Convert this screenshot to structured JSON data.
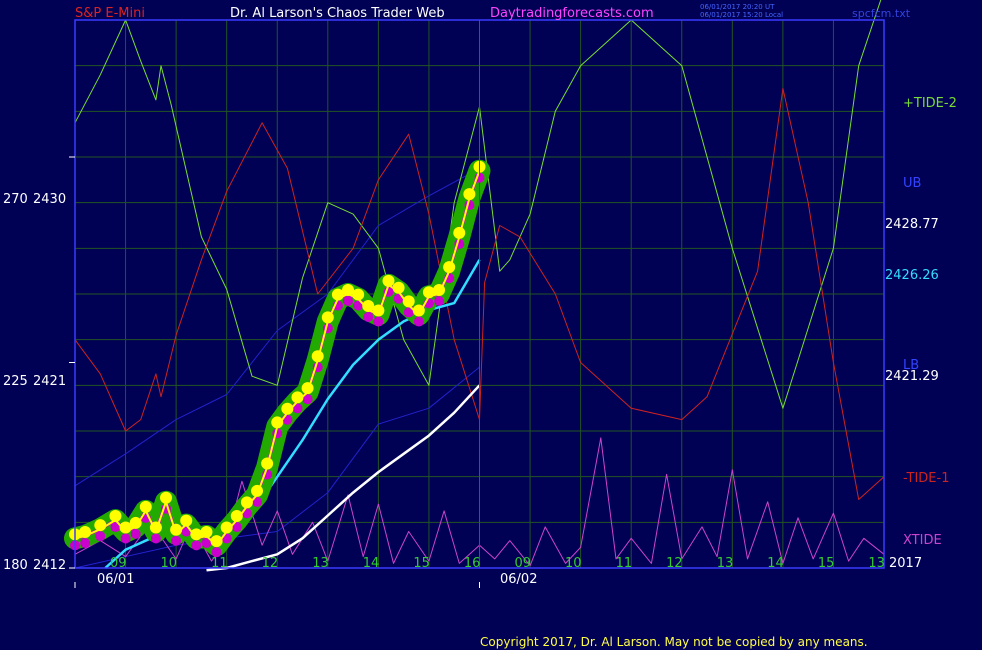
{
  "header": {
    "symbol": "S&P E-Mini",
    "title": "Dr. Al Larson's Chaos Trader Web",
    "site": "Daytradingforecasts.com",
    "stamp_line1": "06/01/2017 20:20 UT",
    "stamp_line2": "06/01/2017 15:20 Local",
    "file": "spcfcm.txt"
  },
  "footer": {
    "copyright": "Copyright 2017, Dr. Al Larson. May not be copied by any means."
  },
  "colors": {
    "background": "#000055",
    "frame": "#3b3bff",
    "grid": "#225522",
    "tide_plus": "#77dd33",
    "tide_minus": "#cc2222",
    "xtide": "#cc44cc",
    "fast_avg": "#33ddff",
    "slow_avg": "#ffffff",
    "band": "#2222cc",
    "price_yellow": "#ffff00",
    "price_magenta": "#cc00cc",
    "price_halo": "#22aa00"
  },
  "chart_data": {
    "type": "line",
    "title": "S&P E-Mini",
    "y_axis": {
      "range": [
        2412,
        2436
      ],
      "tick_labels": [
        {
          "inner": "180",
          "price": "2412",
          "value": 2412
        },
        {
          "inner": "225",
          "price": "2421",
          "value": 2421
        },
        {
          "inner": "270",
          "price": "2430",
          "value": 2430
        }
      ]
    },
    "x_axis": {
      "hour_ticks": [
        "09",
        "10",
        "11",
        "12",
        "13",
        "14",
        "15",
        "16",
        "09",
        "10",
        "11",
        "12",
        "13",
        "14",
        "15",
        "13"
      ],
      "dates": [
        "06/01",
        "06/02"
      ],
      "year": "2017",
      "range": [
        8,
        24
      ]
    },
    "right_labels": [
      {
        "text": "+TIDE-2",
        "role": "tide_plus"
      },
      {
        "text": "UB",
        "role": "band"
      },
      {
        "text": "2428.77",
        "role": "value_white"
      },
      {
        "text": "2426.26",
        "role": "value_cyan"
      },
      {
        "text": "LB",
        "role": "band"
      },
      {
        "text": "2421.29",
        "role": "value_white"
      },
      {
        "text": "-TIDE-1",
        "role": "tide_minus"
      },
      {
        "text": "XTIDE",
        "role": "xtide"
      }
    ],
    "grid": true,
    "series": [
      {
        "role": "price",
        "color": "#ffff00",
        "x": [
          8.0,
          8.2,
          8.5,
          8.8,
          9.0,
          9.2,
          9.4,
          9.6,
          9.8,
          10.0,
          10.2,
          10.4,
          10.6,
          10.8,
          11.0,
          11.2,
          11.4,
          11.6,
          11.8,
          12.0,
          12.2,
          12.4,
          12.6,
          12.8,
          13.0,
          13.2,
          13.4,
          13.6,
          13.8,
          14.0,
          14.2,
          14.4,
          14.6,
          14.8,
          15.0,
          15.2,
          15.4,
          15.6,
          15.8,
          16.0
        ],
        "y": [
          2413.3,
          2413.4,
          2413.7,
          2414.1,
          2413.6,
          2413.8,
          2414.5,
          2413.6,
          2414.9,
          2413.5,
          2413.9,
          2413.3,
          2413.4,
          2413.0,
          2413.6,
          2414.1,
          2414.7,
          2415.2,
          2416.4,
          2418.2,
          2418.8,
          2419.3,
          2419.7,
          2421.1,
          2422.8,
          2423.8,
          2424.0,
          2423.8,
          2423.3,
          2423.1,
          2424.4,
          2424.1,
          2423.5,
          2423.1,
          2423.9,
          2424.0,
          2425.0,
          2426.5,
          2428.2,
          2429.4
        ]
      },
      {
        "role": "fast_average",
        "color": "#33ddff",
        "x": [
          8.6,
          9.0,
          9.5,
          10.0,
          10.5,
          11.0,
          11.5,
          12.0,
          12.5,
          13.0,
          13.5,
          14.0,
          14.5,
          15.0,
          15.5,
          16.0
        ],
        "y": [
          2412.0,
          2412.8,
          2413.3,
          2413.5,
          2413.3,
          2413.7,
          2414.4,
          2416.0,
          2417.6,
          2419.4,
          2420.9,
          2422.0,
          2422.8,
          2423.3,
          2423.6,
          2425.5
        ]
      },
      {
        "role": "slow_average",
        "color": "#ffffff",
        "x": [
          10.6,
          11.0,
          11.5,
          12.0,
          12.5,
          13.0,
          13.5,
          14.0,
          14.5,
          15.0,
          15.5,
          16.0
        ],
        "y": [
          2411.9,
          2412.0,
          2412.3,
          2412.6,
          2413.3,
          2414.3,
          2415.3,
          2416.2,
          2417.0,
          2417.8,
          2418.8,
          2420.0
        ]
      },
      {
        "role": "upper_band",
        "color": "#2222cc",
        "x": [
          8.0,
          9.0,
          10.0,
          11.0,
          12.0,
          13.0,
          14.0,
          15.0,
          16.0
        ],
        "y": [
          2415.6,
          2417.0,
          2418.5,
          2419.6,
          2422.4,
          2424.0,
          2427.0,
          2428.3,
          2429.5
        ]
      },
      {
        "role": "lower_band",
        "color": "#2222cc",
        "x": [
          8.0,
          9.0,
          10.0,
          11.0,
          12.0,
          13.0,
          14.0,
          15.0,
          16.0
        ],
        "y": [
          2412.0,
          2412.5,
          2413.0,
          2413.3,
          2413.6,
          2415.3,
          2418.3,
          2419.0,
          2420.8
        ]
      },
      {
        "role": "tide_plus",
        "color": "#77dd33",
        "x": [
          8.0,
          8.5,
          9.0,
          9.3,
          9.6,
          9.7,
          9.9,
          10.5,
          11.0,
          11.5,
          12.0,
          12.5,
          13.0,
          13.5,
          14.0,
          14.5,
          15.0,
          15.5,
          16.0,
          16.4,
          16.6,
          17.0,
          17.5,
          18.0,
          19.0,
          20.0,
          21.0,
          22.0,
          23.0,
          23.5,
          24.0
        ],
        "y": [
          2431.5,
          2433.6,
          2436.0,
          2434.2,
          2432.5,
          2434.0,
          2432.3,
          2426.5,
          2424.2,
          2420.4,
          2420.0,
          2424.7,
          2428.0,
          2427.5,
          2426.0,
          2422.0,
          2420.0,
          2428.0,
          2432.2,
          2425.0,
          2425.5,
          2427.5,
          2432.0,
          2434.0,
          2436.0,
          2434.0,
          2426.0,
          2419.0,
          2426.0,
          2434.0,
          2437.3
        ]
      },
      {
        "role": "tide_minus",
        "color": "#cc2222",
        "x": [
          8.0,
          8.5,
          9.0,
          9.3,
          9.6,
          9.7,
          10.0,
          10.5,
          11.0,
          11.7,
          12.2,
          12.8,
          13.5,
          14.0,
          14.6,
          15.0,
          15.5,
          16.0,
          16.1,
          16.4,
          16.8,
          17.5,
          18.0,
          19.0,
          20.0,
          20.5,
          21.5,
          22.0,
          22.5,
          23.0,
          23.5,
          24.0
        ],
        "y": [
          2422.0,
          2420.5,
          2418.0,
          2418.5,
          2420.5,
          2419.5,
          2422.2,
          2425.5,
          2428.5,
          2431.5,
          2429.5,
          2424.0,
          2426.0,
          2429.0,
          2431.0,
          2427.5,
          2422.0,
          2418.5,
          2424.5,
          2427.0,
          2426.5,
          2424.0,
          2421.0,
          2419.0,
          2418.5,
          2419.5,
          2425.0,
          2433.0,
          2428.0,
          2421.0,
          2415.0,
          2416.0
        ]
      },
      {
        "role": "xtide",
        "color": "#cc44cc",
        "x": [
          8.0,
          8.5,
          9.0,
          9.5,
          10.0,
          10.3,
          10.7,
          11.0,
          11.3,
          11.7,
          12.0,
          12.3,
          12.7,
          13.0,
          13.4,
          13.7,
          14.0,
          14.3,
          14.6,
          15.0,
          15.3,
          15.6,
          16.0,
          16.3,
          16.6,
          17.0,
          17.3,
          17.7,
          18.0,
          18.4,
          18.7,
          19.0,
          19.4,
          19.7,
          20.0,
          20.4,
          20.7,
          21.0,
          21.3,
          21.7,
          22.0,
          22.3,
          22.6,
          23.0,
          23.3,
          23.6,
          24.0
        ],
        "y": [
          2412.6,
          2413.2,
          2412.5,
          2414.0,
          2412.4,
          2413.9,
          2412.3,
          2413.2,
          2415.8,
          2413.0,
          2414.5,
          2412.6,
          2414.0,
          2412.3,
          2415.2,
          2412.5,
          2414.8,
          2412.2,
          2413.6,
          2412.3,
          2414.5,
          2412.2,
          2413.0,
          2412.4,
          2413.2,
          2412.1,
          2413.8,
          2412.2,
          2412.9,
          2417.7,
          2412.4,
          2413.3,
          2412.2,
          2416.1,
          2412.4,
          2413.8,
          2412.5,
          2416.3,
          2412.4,
          2414.9,
          2412.2,
          2414.2,
          2412.4,
          2414.4,
          2412.3,
          2413.3,
          2412.6
        ]
      }
    ]
  }
}
